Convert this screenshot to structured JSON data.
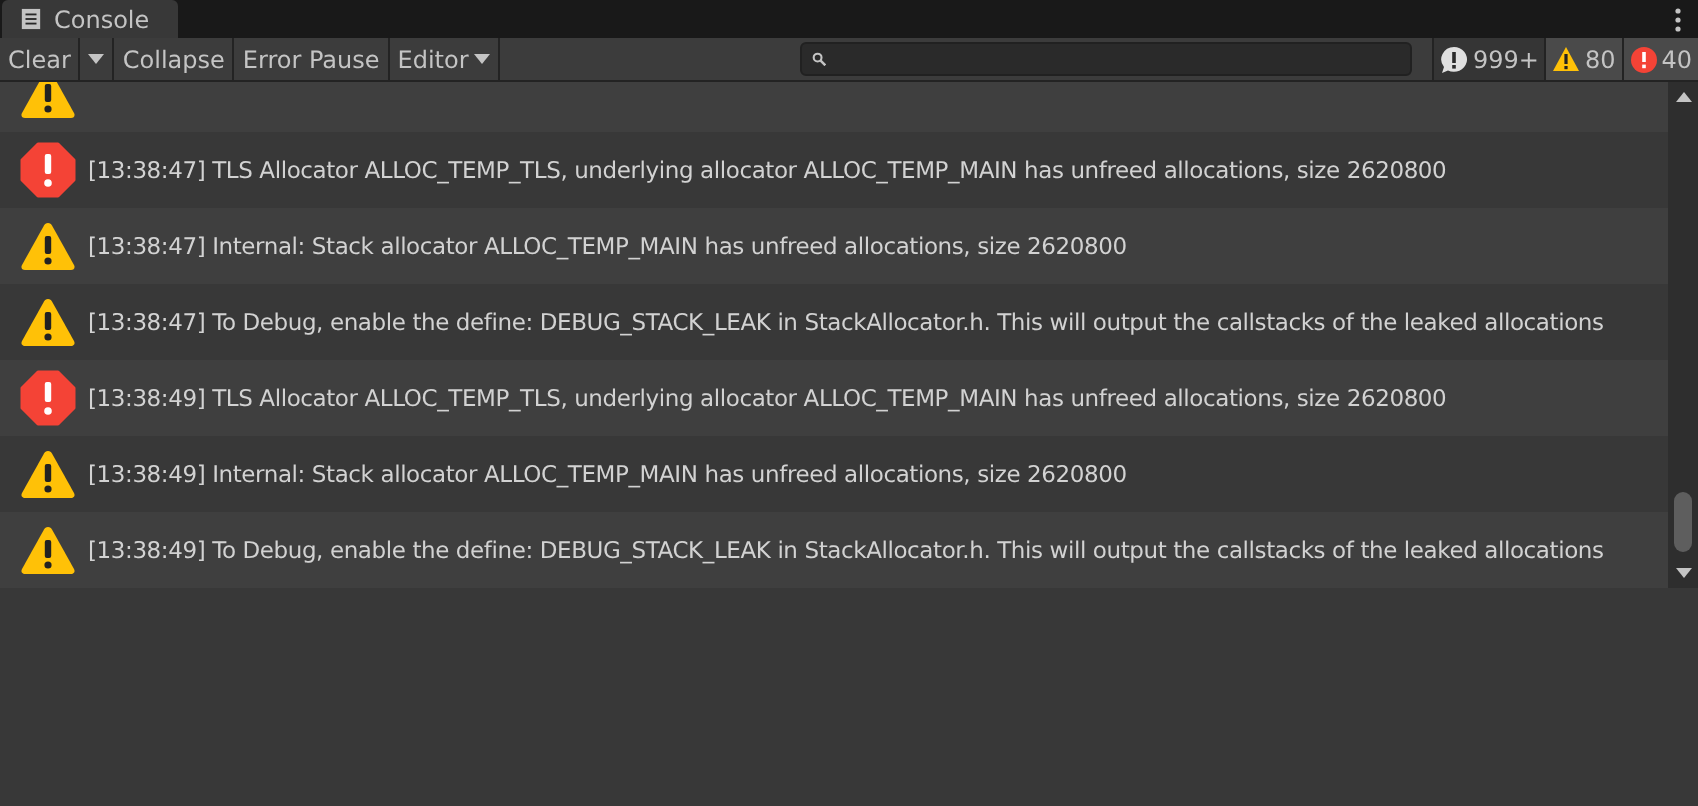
{
  "tab": {
    "title": "Console"
  },
  "toolbar": {
    "buttons": [
      {
        "label": "Clear",
        "kind": "split",
        "on": false
      },
      {
        "label": "Collapse",
        "kind": "toggle",
        "on": false
      },
      {
        "label": "Error Pause",
        "kind": "toggle",
        "on": false
      },
      {
        "label": "Editor",
        "kind": "dropdown",
        "on": false
      }
    ],
    "counters": [
      {
        "kind": "log",
        "count": "999+",
        "on": false
      },
      {
        "kind": "warning",
        "count": "80",
        "on": true
      },
      {
        "kind": "error",
        "count": "40",
        "on": true
      }
    ]
  },
  "entries": [
    {
      "kind": "warning"
    },
    {
      "kind": "error",
      "message": "[13:38:47] TLS Allocator ALLOC_TEMP_TLS, underlying allocator ALLOC_TEMP_MAIN has unfreed allocations, size 2620800"
    },
    {
      "kind": "warning",
      "message": "[13:38:47] Internal: Stack allocator ALLOC_TEMP_MAIN has unfreed allocations, size 2620800"
    },
    {
      "kind": "warning",
      "message": "[13:38:47] To Debug, enable the define: DEBUG_STACK_LEAK in StackAllocator.h. This will output the callstacks of the leaked allocations"
    },
    {
      "kind": "error",
      "message": "[13:38:49] TLS Allocator ALLOC_TEMP_TLS, underlying allocator ALLOC_TEMP_MAIN has unfreed allocations, size 2620800"
    },
    {
      "kind": "warning",
      "message": "[13:38:49] Internal: Stack allocator ALLOC_TEMP_MAIN has unfreed allocations, size 2620800"
    },
    {
      "kind": "warning",
      "message": "[13:38:49] To Debug, enable the define: DEBUG_STACK_LEAK in StackAllocator.h. This will output the callstacks of the leaked allocations"
    }
  ]
}
